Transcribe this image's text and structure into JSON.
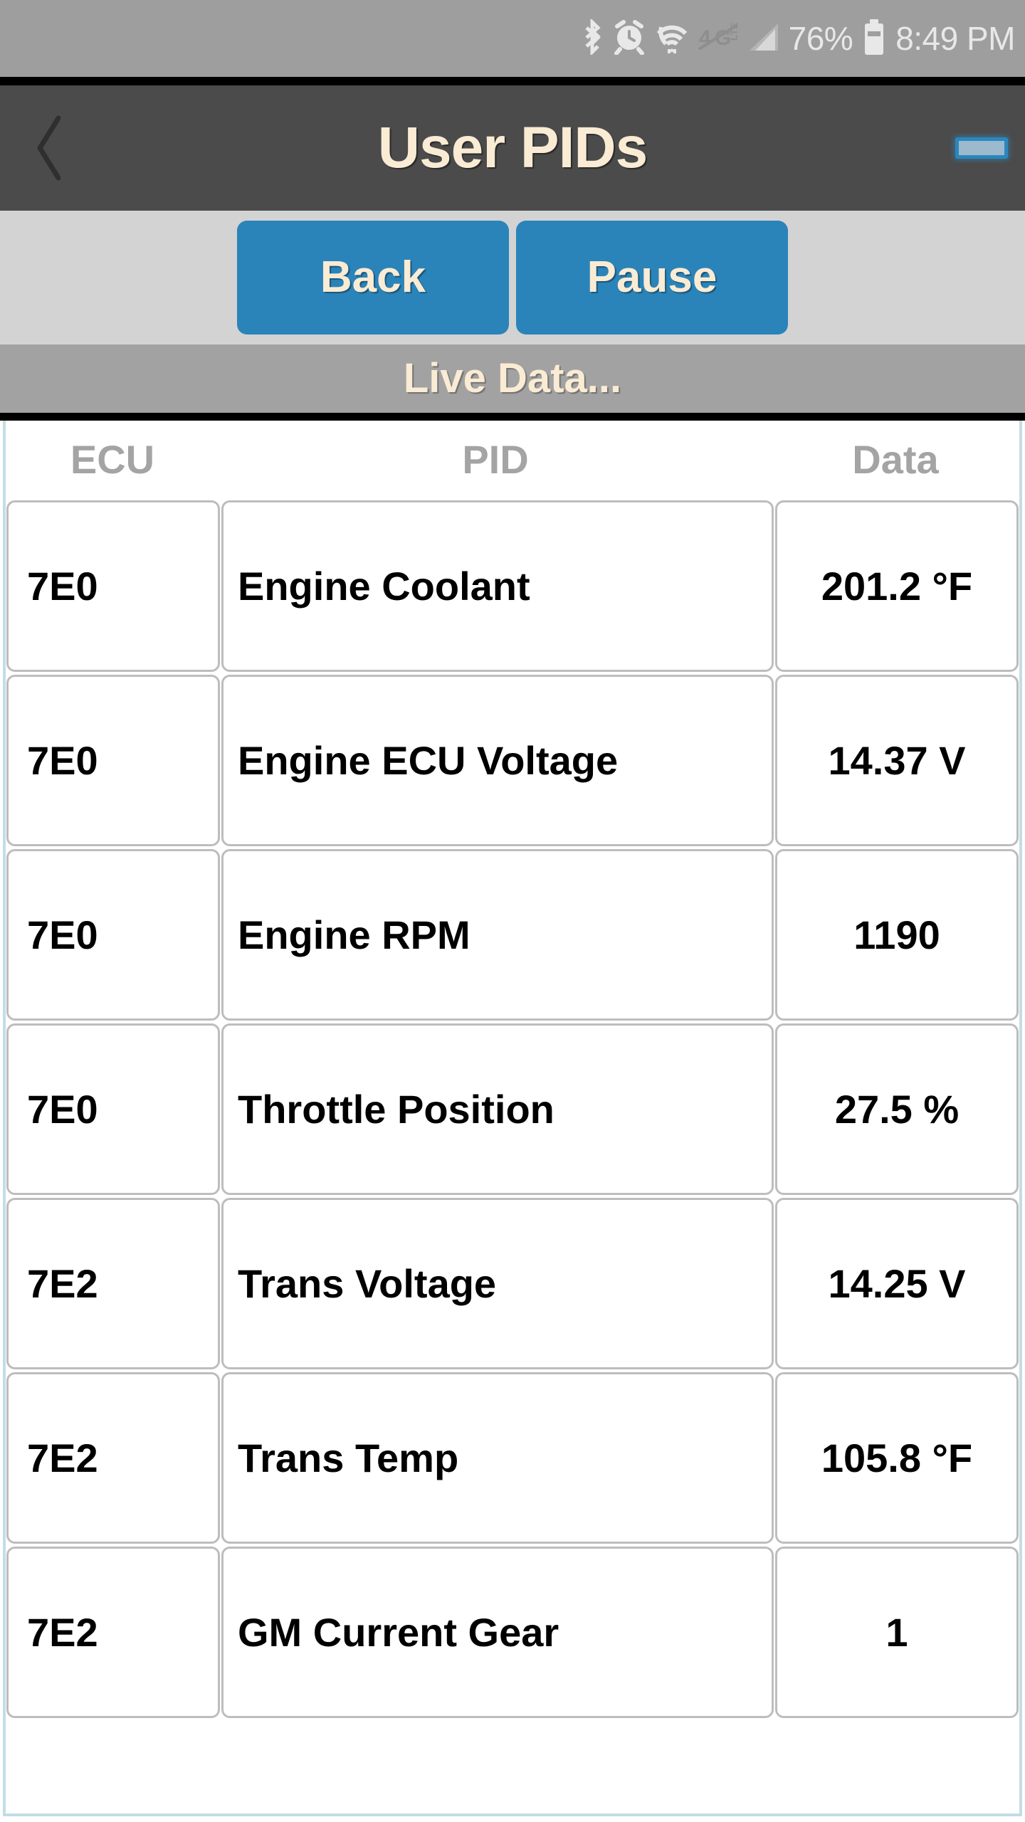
{
  "status_bar": {
    "icons": [
      "bluetooth-icon",
      "alarm-clock-icon",
      "wifi-icon",
      "lte-disabled-icon",
      "cellular-signal-icon"
    ],
    "battery_percent": "76%",
    "battery_icon": "battery-icon",
    "clock": "8:49 PM"
  },
  "title_bar": {
    "back_icon": "back-chevron-icon",
    "title": "User PIDs",
    "minimize_icon": "minimize-icon"
  },
  "toolbar": {
    "back_label": "Back",
    "pause_label": "Pause"
  },
  "status_strip": {
    "label": "Live Data..."
  },
  "table": {
    "headers": [
      "ECU",
      "PID",
      "Data"
    ],
    "rows": [
      {
        "ecu": "7E0",
        "pid": "Engine Coolant",
        "data": "201.2 °F"
      },
      {
        "ecu": "7E0",
        "pid": "Engine ECU Voltage",
        "data": "14.37 V"
      },
      {
        "ecu": "7E0",
        "pid": "Engine RPM",
        "data": "1190"
      },
      {
        "ecu": "7E0",
        "pid": "Throttle Position",
        "data": "27.5 %"
      },
      {
        "ecu": "7E2",
        "pid": "Trans Voltage",
        "data": "14.25 V"
      },
      {
        "ecu": "7E2",
        "pid": "Trans Temp",
        "data": "105.8 °F"
      },
      {
        "ecu": "7E2",
        "pid": "GM Current Gear",
        "data": "1"
      }
    ]
  },
  "colors": {
    "status_bar_bg": "#9e9e9e",
    "title_bar_bg": "#4b4b4b",
    "title_text": "#faebd4",
    "toolbar_bg": "#d3d3d3",
    "button_blue": "#2a84b9",
    "strip_bg": "#a2a2a2",
    "panel_border": "#c3dde6",
    "cell_border": "#bdbdbd",
    "header_text": "#a4a4a4"
  }
}
